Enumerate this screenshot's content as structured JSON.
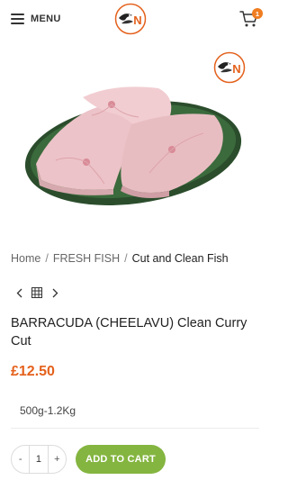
{
  "header": {
    "menu_label": "MENU",
    "cart_count": "1",
    "logo_letter": "N"
  },
  "breadcrumb": {
    "items": [
      "Home",
      "FRESH FISH"
    ],
    "current": "Cut and Clean Fish",
    "separator": "/"
  },
  "product": {
    "title": "BARRACUDA (CHEELAVU) Clean Curry Cut",
    "price": "£12.50",
    "weight": "500g-1.2Kg"
  },
  "quantity": {
    "minus": "-",
    "value": "1",
    "plus": "+"
  },
  "actions": {
    "add_to_cart": "ADD TO CART"
  },
  "colors": {
    "accent_orange": "#e4611c",
    "button_green": "#84b540",
    "badge_orange": "#f07d21",
    "plate_green": "#2b4d2c",
    "fish_pink": "#ecc3c8"
  }
}
